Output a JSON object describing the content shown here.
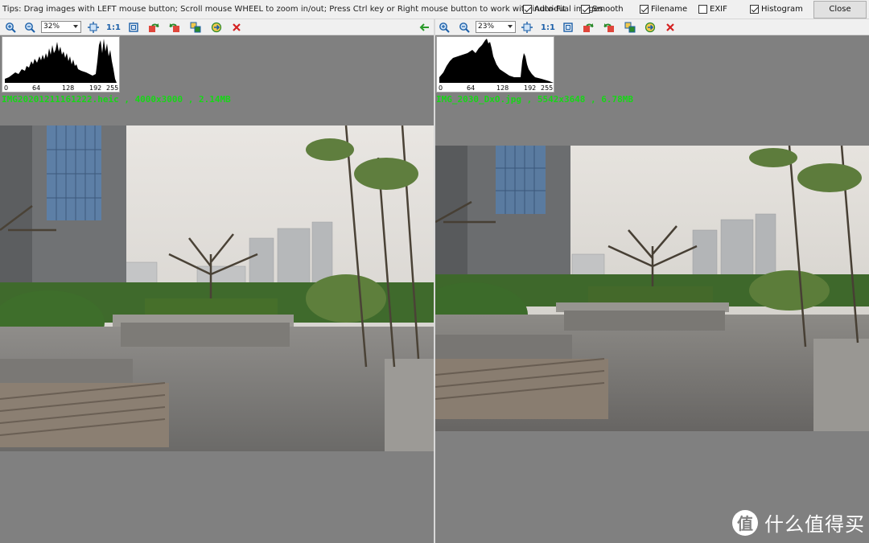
{
  "tips": "Tips: Drag images with LEFT mouse button; Scroll mouse WHEEL to zoom in/out; Press Ctrl key or Right mouse button to work with individual images.",
  "options": [
    {
      "label": "Auto-Fit",
      "checked": true
    },
    {
      "label": "Smooth",
      "checked": true
    },
    {
      "label": "Filename",
      "checked": true
    },
    {
      "label": "EXIF",
      "checked": false
    },
    {
      "label": "Histogram",
      "checked": true
    }
  ],
  "close_label": "Close",
  "left": {
    "zoom": "32%",
    "one_to_one": "1:1",
    "histogram_ticks": [
      "0",
      "64",
      "128",
      "192",
      "255"
    ],
    "file_info": "IMG20201211161222.heic , 4000x3000 , 2.14MB"
  },
  "right": {
    "zoom": "23%",
    "one_to_one": "1:1",
    "histogram_ticks": [
      "0",
      "64",
      "128",
      "192",
      "255"
    ],
    "file_info": "IMG_2030_DxO.jpg , 5542x3648 , 6.78MB"
  },
  "watermark": {
    "logo_char": "值",
    "text": "什么值得买"
  },
  "colors": {
    "accent_blue": "#1b5fa8",
    "filename_green": "#17d617",
    "delete_red": "#d42020",
    "background": "#808080"
  }
}
